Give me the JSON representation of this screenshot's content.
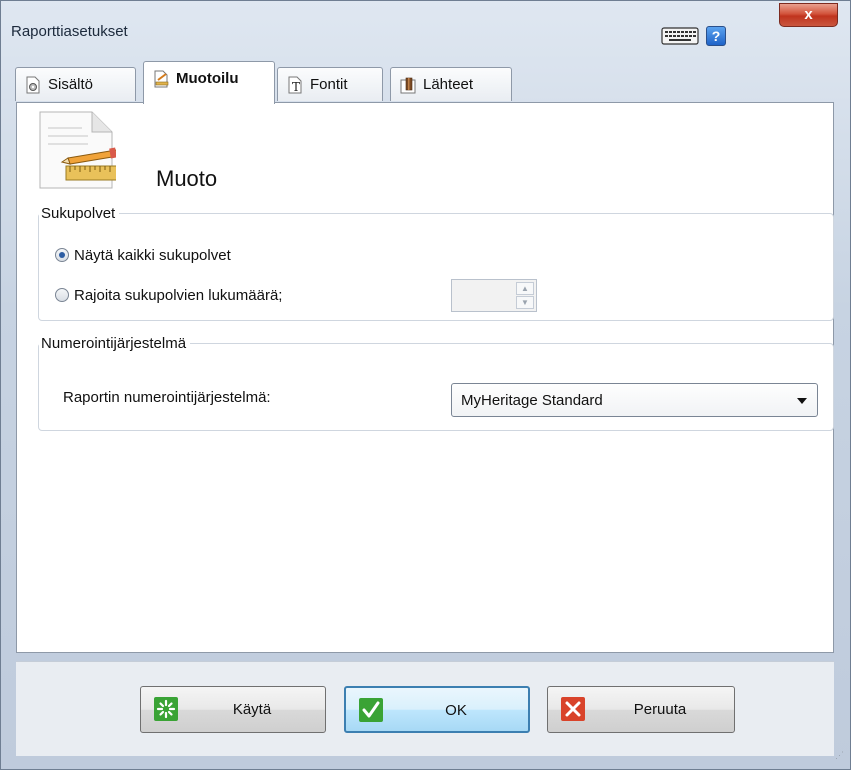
{
  "window": {
    "title": "Raporttiasetukset",
    "close_label": "x",
    "help_label": "?"
  },
  "tabs": [
    {
      "label": "Sisältö",
      "active": false,
      "icon": "gear-document-icon"
    },
    {
      "label": "Muotoilu",
      "active": true,
      "icon": "format-document-icon"
    },
    {
      "label": "Fontit",
      "active": false,
      "icon": "font-icon"
    },
    {
      "label": "Lähteet",
      "active": false,
      "icon": "sources-icon"
    }
  ],
  "page": {
    "title": "Muoto",
    "icon": "document-ruler-pencil-icon"
  },
  "generations": {
    "legend": "Sukupolvet",
    "option_all": "Näytä kaikki sukupolvet",
    "option_limit": "Rajoita sukupolvien lukumäärä;",
    "selected": "all",
    "limit_value": ""
  },
  "numbering": {
    "legend": "Numerointijärjestelmä",
    "label": "Raportin numerointijärjestelmä:",
    "selected": "MyHeritage Standard"
  },
  "buttons": {
    "apply": "Käytä",
    "ok": "OK",
    "cancel": "Peruuta"
  },
  "colors": {
    "accent": "#3c7fb1",
    "close": "#c9452c",
    "apply_icon": "#3aa335",
    "ok_icon": "#3aa335",
    "cancel_icon": "#d9432a"
  }
}
